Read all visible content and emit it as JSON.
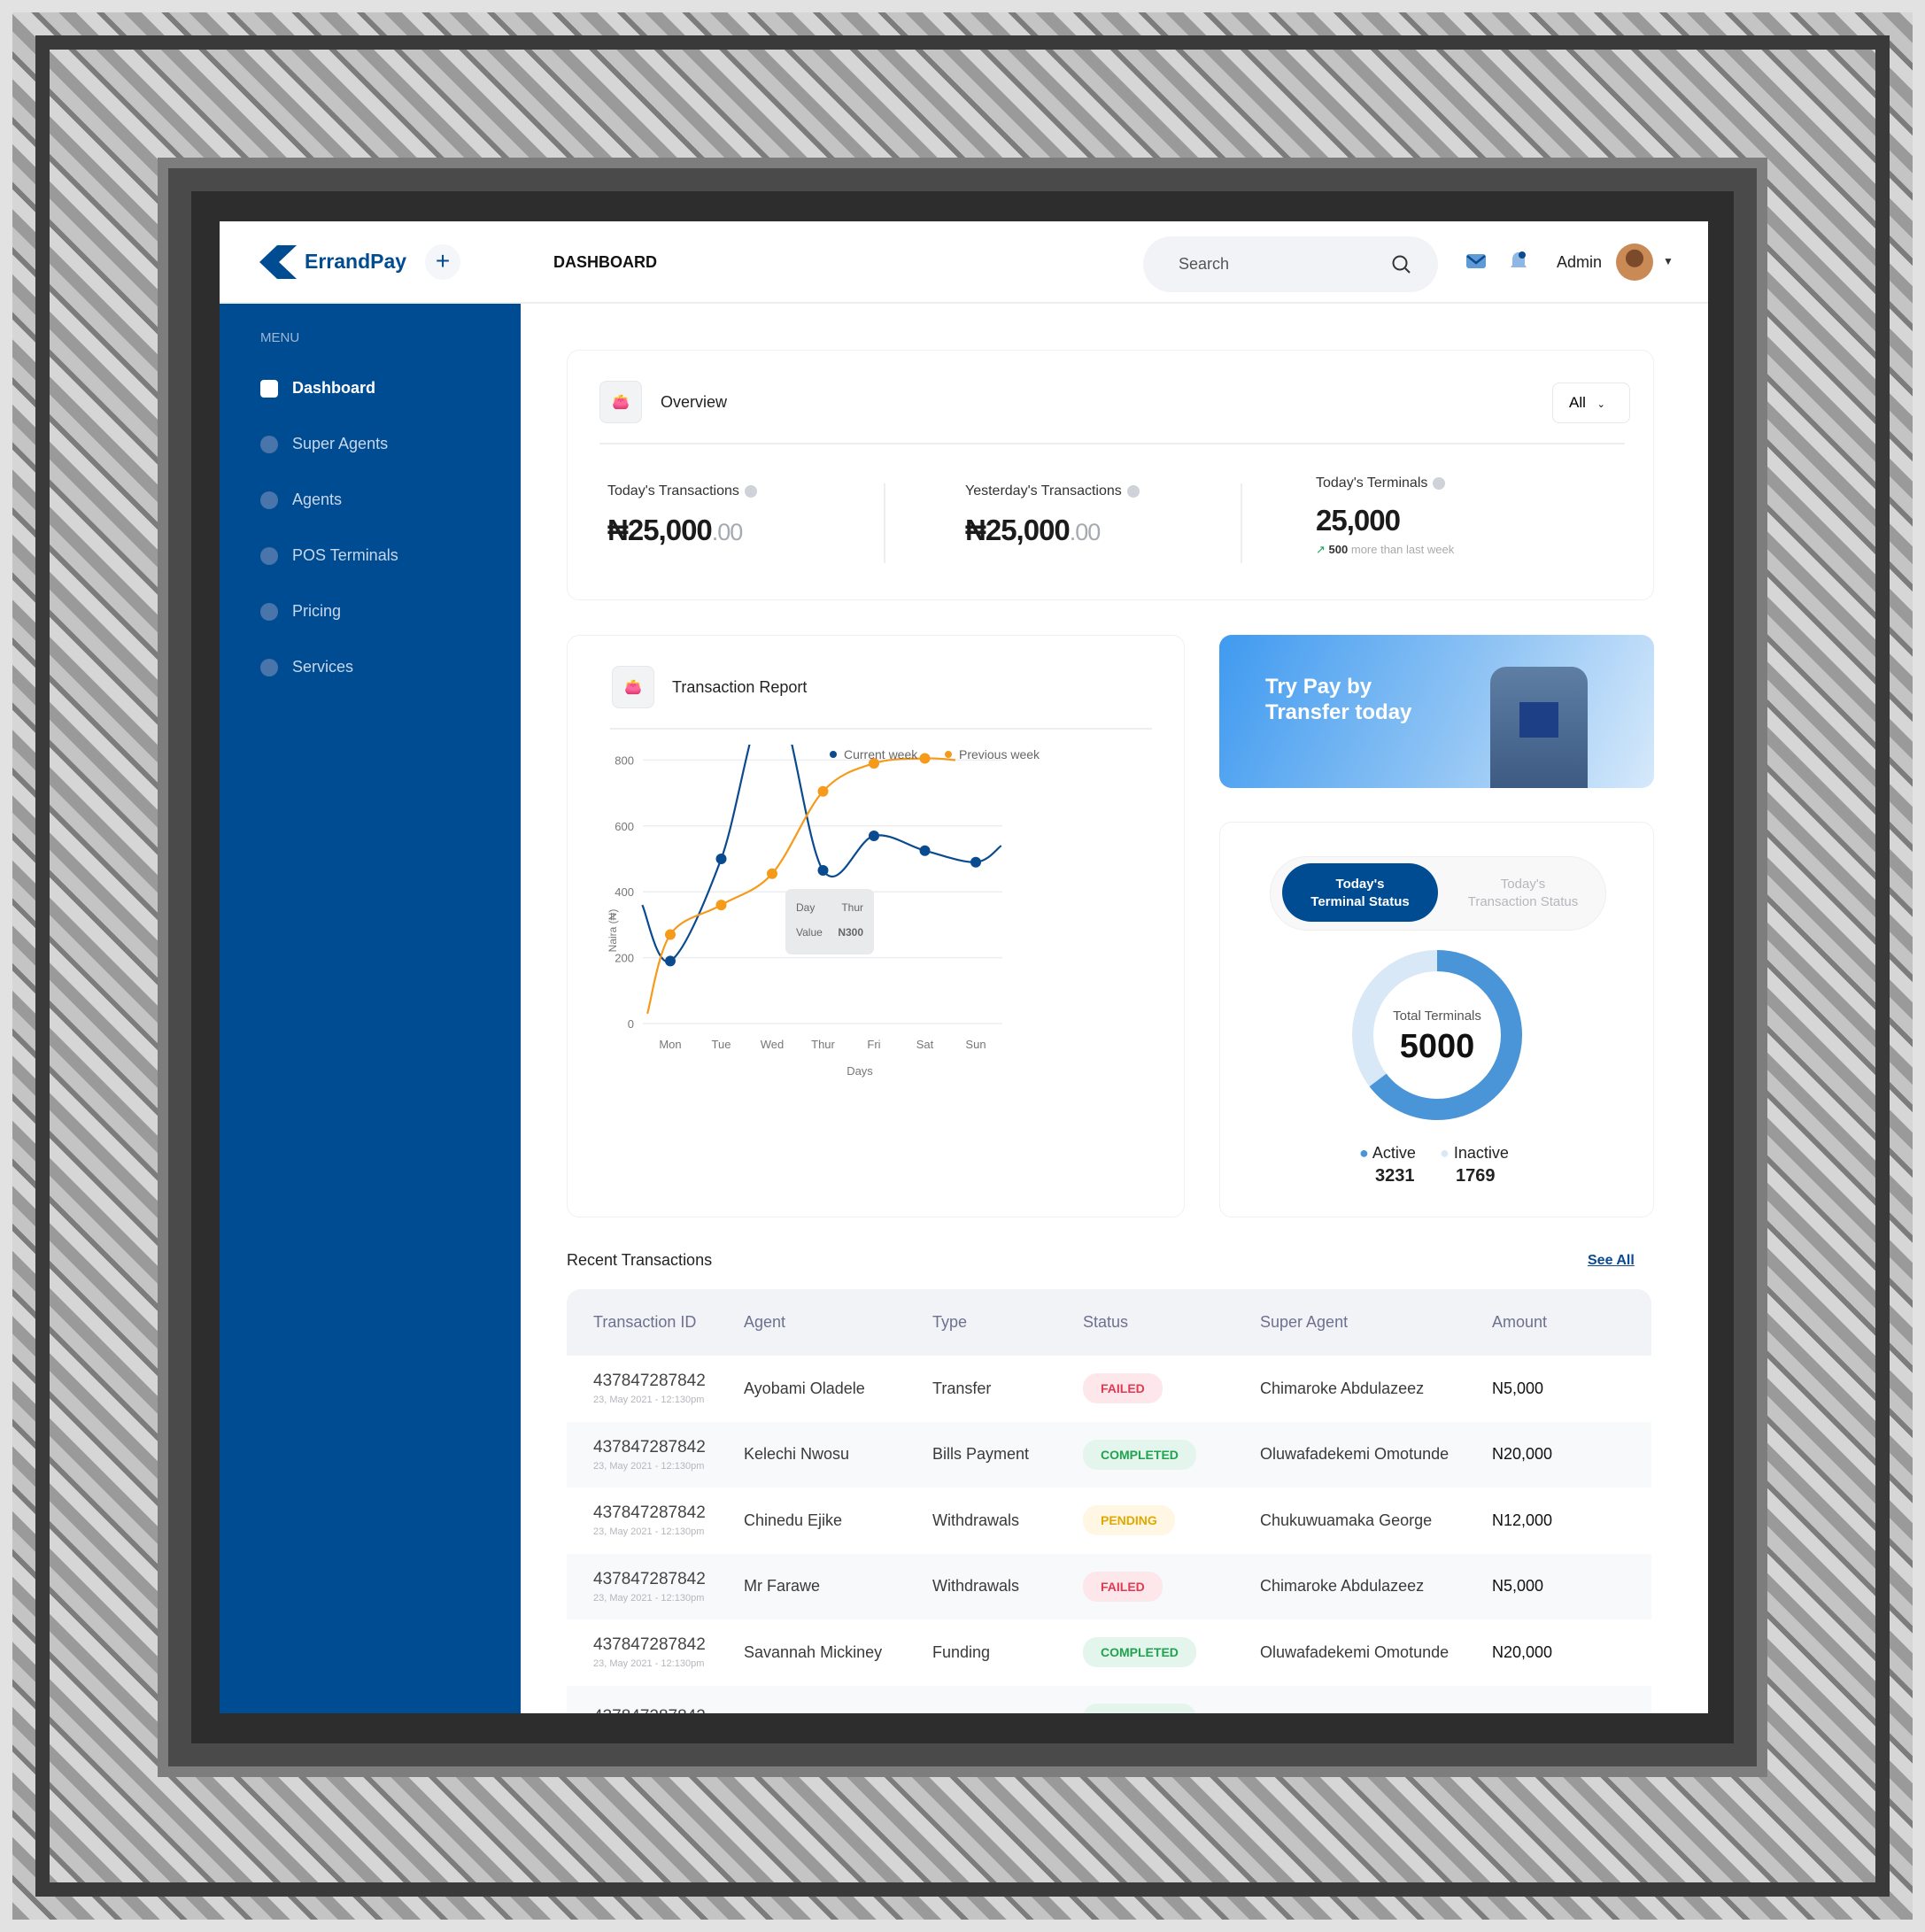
{
  "header": {
    "brand": "ErrandPay",
    "page_title": "DASHBOARD",
    "search_placeholder": "Search",
    "user_name": "Admin"
  },
  "sidebar": {
    "menu_label": "MENU",
    "items": [
      {
        "label": "Dashboard",
        "active": true
      },
      {
        "label": "Super Agents"
      },
      {
        "label": "Agents"
      },
      {
        "label": "POS Terminals"
      },
      {
        "label": "Pricing"
      },
      {
        "label": "Services"
      }
    ]
  },
  "overview": {
    "title": "Overview",
    "filter": "All",
    "stats": [
      {
        "label": "Today's Transactions",
        "currency": "₦",
        "value": "25,000",
        "decimals": ".00"
      },
      {
        "label": "Yesterday's Transactions",
        "currency": "₦",
        "value": "25,000",
        "decimals": ".00"
      },
      {
        "label": "Today's Terminals",
        "value": "25,000",
        "delta": "500",
        "delta_text": "more than last week"
      }
    ]
  },
  "report": {
    "title": "Transaction Report",
    "tooltip": {
      "day_label": "Day",
      "day": "Thur",
      "value_label": "Value",
      "value": "N300"
    }
  },
  "chart_data": {
    "type": "line",
    "xlabel": "Days",
    "ylabel": "Naira (₦)",
    "ylim": [
      0,
      1000
    ],
    "yticks": [
      "0",
      "200",
      "400",
      "600",
      "800",
      "1,000"
    ],
    "categories": [
      "Mon",
      "Tue",
      "Wed",
      "Thur",
      "Fri",
      "Sat",
      "Sun"
    ],
    "grid": true,
    "legend": "top-right",
    "series": [
      {
        "name": "Current week",
        "color": "#0a4a8f",
        "values": [
          190,
          500,
          1015,
          465,
          570,
          525,
          490
        ]
      },
      {
        "name": "Previous week",
        "color": "#f59a1b",
        "values": [
          270,
          360,
          455,
          705,
          790,
          805,
          null
        ]
      }
    ]
  },
  "banner": {
    "line1": "Try Pay by",
    "line2": "Transfer today"
  },
  "status": {
    "tab_active_1": "Today's",
    "tab_active_2": "Terminal Status",
    "tab_other_1": "Today's",
    "tab_other_2": "Transaction Status",
    "center_label": "Total Terminals",
    "total": "5000",
    "active_label": "Active",
    "active": 3231,
    "inactive_label": "Inactive",
    "inactive": 1769,
    "active_color": "#4a94d8",
    "inactive_color": "#d8e8f7"
  },
  "transactions": {
    "title": "Recent Transactions",
    "see_all": "See All",
    "columns": [
      "Transaction ID",
      "Agent",
      "Type",
      "Status",
      "Super Agent",
      "Amount"
    ],
    "rows": [
      {
        "id": "437847287842",
        "date": "23, May 2021 - 12:130pm",
        "agent": "Ayobami Oladele",
        "type": "Transfer",
        "status": "FAILED",
        "super_agent": "Chimaroke Abdulazeez",
        "amount": "N5,000"
      },
      {
        "id": "437847287842",
        "date": "23, May 2021 - 12:130pm",
        "agent": "Kelechi Nwosu",
        "type": "Bills Payment",
        "status": "COMPLETED",
        "super_agent": "Oluwafadekemi Omotunde",
        "amount": "N20,000"
      },
      {
        "id": "437847287842",
        "date": "23, May 2021 - 12:130pm",
        "agent": "Chinedu Ejike",
        "type": "Withdrawals",
        "status": "PENDING",
        "super_agent": "Chukuwuamaka George",
        "amount": "N12,000"
      },
      {
        "id": "437847287842",
        "date": "23, May 2021 - 12:130pm",
        "agent": "Mr Farawe",
        "type": "Withdrawals",
        "status": "FAILED",
        "super_agent": "Chimaroke Abdulazeez",
        "amount": "N5,000"
      },
      {
        "id": "437847287842",
        "date": "23, May 2021 - 12:130pm",
        "agent": "Savannah Mickiney",
        "type": "Funding",
        "status": "COMPLETED",
        "super_agent": "Oluwafadekemi Omotunde",
        "amount": "N20,000"
      },
      {
        "id": "437847287842",
        "date": "",
        "agent": "",
        "type": "",
        "status": "COMPLETED",
        "super_agent": "",
        "amount": ""
      }
    ]
  }
}
